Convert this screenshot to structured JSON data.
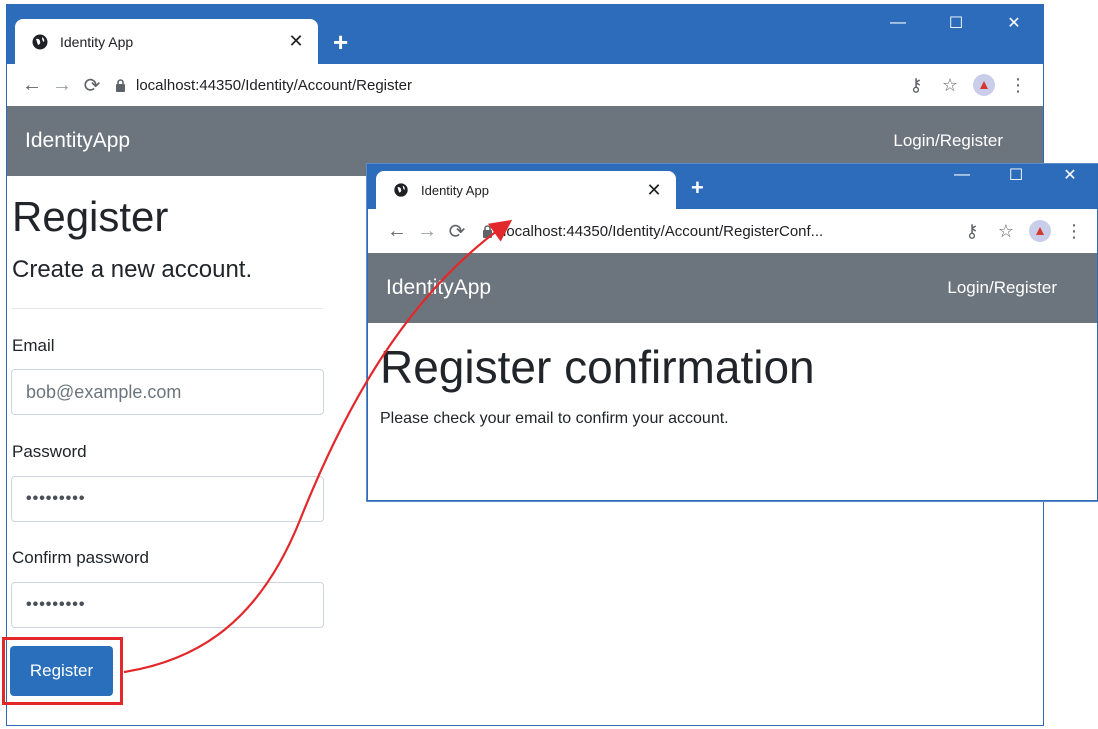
{
  "back_window": {
    "tab_title": "Identity App",
    "url": "localhost:44350/Identity/Account/Register",
    "navbar": {
      "brand": "IdentityApp",
      "link": "Login/Register"
    },
    "page": {
      "title": "Register",
      "subtitle": "Create a new account.",
      "email_label": "Email",
      "email_value": "bob@example.com",
      "password_label": "Password",
      "password_value": "•••••••••",
      "confirm_label": "Confirm password",
      "confirm_value": "•••••••••",
      "register_button": "Register"
    }
  },
  "front_window": {
    "tab_title": "Identity App",
    "url": "localhost:44350/Identity/Account/RegisterConf...",
    "navbar": {
      "brand": "IdentityApp",
      "link": "Login/Register"
    },
    "page": {
      "title": "Register confirmation",
      "message": "Please check your email to confirm your account."
    }
  },
  "colors": {
    "titlebar": "#2d6cbb",
    "navbar": "#6c757d",
    "primary_button": "#2a6fbc",
    "annotation": "#e3282b"
  }
}
